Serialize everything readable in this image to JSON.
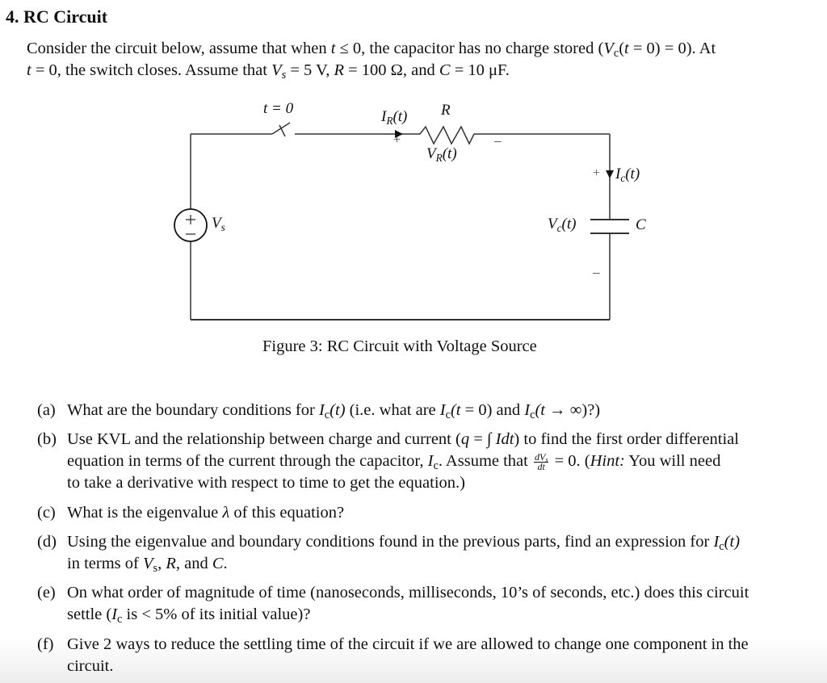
{
  "heading": "4. RC Circuit",
  "intro": {
    "line1_a": "Consider the circuit below, assume that when ",
    "line1_t": "t",
    "line1_b": " ≤ 0, the capacitor has no charge stored (",
    "line1_vc": "V",
    "line1_vc_sub": "c",
    "line1_c": "(",
    "line1_t2": "t",
    "line1_d": " = 0) = 0).  At",
    "line2_t": "t",
    "line2_a": " = 0, the switch closes. Assume that ",
    "line2_vs": "V",
    "line2_vs_sub": "s",
    "line2_b": " = 5 V, ",
    "line2_r": "R",
    "line2_c": " = 100 Ω, and ",
    "line2_cap": "C",
    "line2_d": " = 10 μF."
  },
  "circuit": {
    "switch_label": "t = 0",
    "current_r_label": "I",
    "current_r_sub": "R",
    "current_r_arg": "(t)",
    "resistor_label": "R",
    "voltage_r_label": "V",
    "voltage_r_sub": "R",
    "voltage_r_arg": "(t)",
    "plus": "+",
    "minus": "−",
    "source_label": "V",
    "source_sub": "s",
    "current_c_label": "I",
    "current_c_sub": "c",
    "current_c_arg": "(t)",
    "voltage_c_label": "V",
    "voltage_c_sub": "c",
    "voltage_c_arg": "(t)",
    "capacitor_label": "C"
  },
  "caption": "Figure 3: RC Circuit with Voltage Source",
  "questions": [
    {
      "label": "(a)",
      "lines": [
        "What are the boundary conditions for I_c(t) (i.e. what are I_c(t = 0) and I_c(t → ∞)?)"
      ]
    },
    {
      "label": "(b)",
      "lines": [
        "Use KVL and the relationship between charge and current (q = ∫ Idt) to find the first order differential",
        "equation in terms of the current through the capacitor, I_c. Assume that dV_s/dt = 0. (Hint: You will need",
        "to take a derivative with respect to time to get the equation.)"
      ]
    },
    {
      "label": "(c)",
      "lines": [
        "What is the eigenvalue λ of this equation?"
      ]
    },
    {
      "label": "(d)",
      "lines": [
        "Using the eigenvalue and boundary conditions found in the previous parts, find an expression for I_c(t)",
        "in terms of V_s, R, and C."
      ]
    },
    {
      "label": "(e)",
      "lines": [
        "On what order of magnitude of time (nanoseconds, milliseconds, 10’s of seconds, etc.) does this circuit",
        "settle (I_c is < 5% of its initial value)?"
      ]
    },
    {
      "label": "(f)",
      "lines": [
        "Give 2 ways to reduce the settling time of the circuit if we are allowed to change one component in the",
        "circuit."
      ]
    }
  ],
  "q_text": {
    "a1": "What are the boundary conditions for ",
    "a2": " (i.e. what are ",
    "a3": " = 0) and ",
    "a4": " → ∞)?)",
    "b1_1": "Use KVL and the relationship between charge and current (",
    "b1_q": "q",
    "b1_2": " = ∫ ",
    "b1_idt": "Idt",
    "b1_3": ") to find the first order differential",
    "b2_1": "equation in terms of the current through the capacitor, ",
    "b2_2": ". Assume that ",
    "b2_num": "dV",
    "b2_num_sub": "s",
    "b2_den": "dt",
    "b2_3": " = 0. (",
    "b2_hint": "Hint:",
    "b2_4": " You will need",
    "b3": "to take a derivative with respect to time to get the equation.)",
    "c1": "What is the eigenvalue ",
    "c_lambda": "λ",
    "c2": " of this equation?",
    "d1_1": "Using the eigenvalue and boundary conditions found in the previous parts, find an expression for ",
    "d2_1": "in terms of ",
    "d2_2": ", ",
    "d2_r": "R",
    "d2_3": ", and ",
    "d2_c": "C",
    "d2_4": ".",
    "e1": "On what order of magnitude of time (nanoseconds, milliseconds, 10’s of seconds, etc.) does this circuit",
    "e2_1": "settle (",
    "e2_2": " is < 5% of its initial value)?",
    "f1": "Give 2 ways to reduce the settling time of the circuit if we are allowed to change one component in the",
    "f2": "circuit.",
    "I": "I",
    "c_sub": "c",
    "s_sub": "s",
    "V": "V",
    "t_arg": "(t)",
    "t_open": "(t"
  }
}
